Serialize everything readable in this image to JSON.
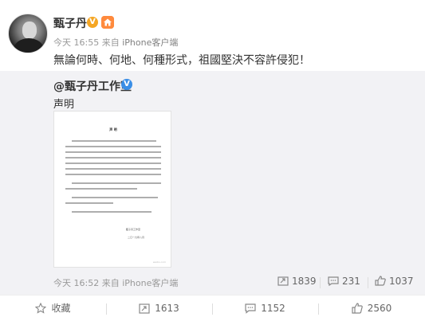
{
  "post": {
    "author": "甄子丹",
    "verified_mark": "V",
    "vip_mark": "🏠",
    "time": "今天 16:55",
    "source_prefix": "来自",
    "source": "iPhone客户端",
    "text": "無論何時、何地、何種形式，祖國堅決不容許侵犯！"
  },
  "repost": {
    "author": "@甄子丹工作室",
    "verified_mark": "V",
    "text": "声明",
    "image": {
      "title": "声 明",
      "signature": "甄子丹工作室",
      "date": "二〇一九年八月",
      "watermark": "weibo.com"
    },
    "time": "今天 16:52",
    "source_prefix": "来自",
    "source": "iPhone客户端",
    "stats": {
      "reposts": "1839",
      "comments": "231",
      "likes": "1037"
    }
  },
  "actions": {
    "favorite": "收藏",
    "repost": "1613",
    "comment": "1152",
    "like": "2560"
  },
  "colors": {
    "repost_bg": "#f2f2f5",
    "verified_gold": "#f5a623",
    "verified_blue": "#3a8ee6",
    "meta_gray": "#999999"
  }
}
